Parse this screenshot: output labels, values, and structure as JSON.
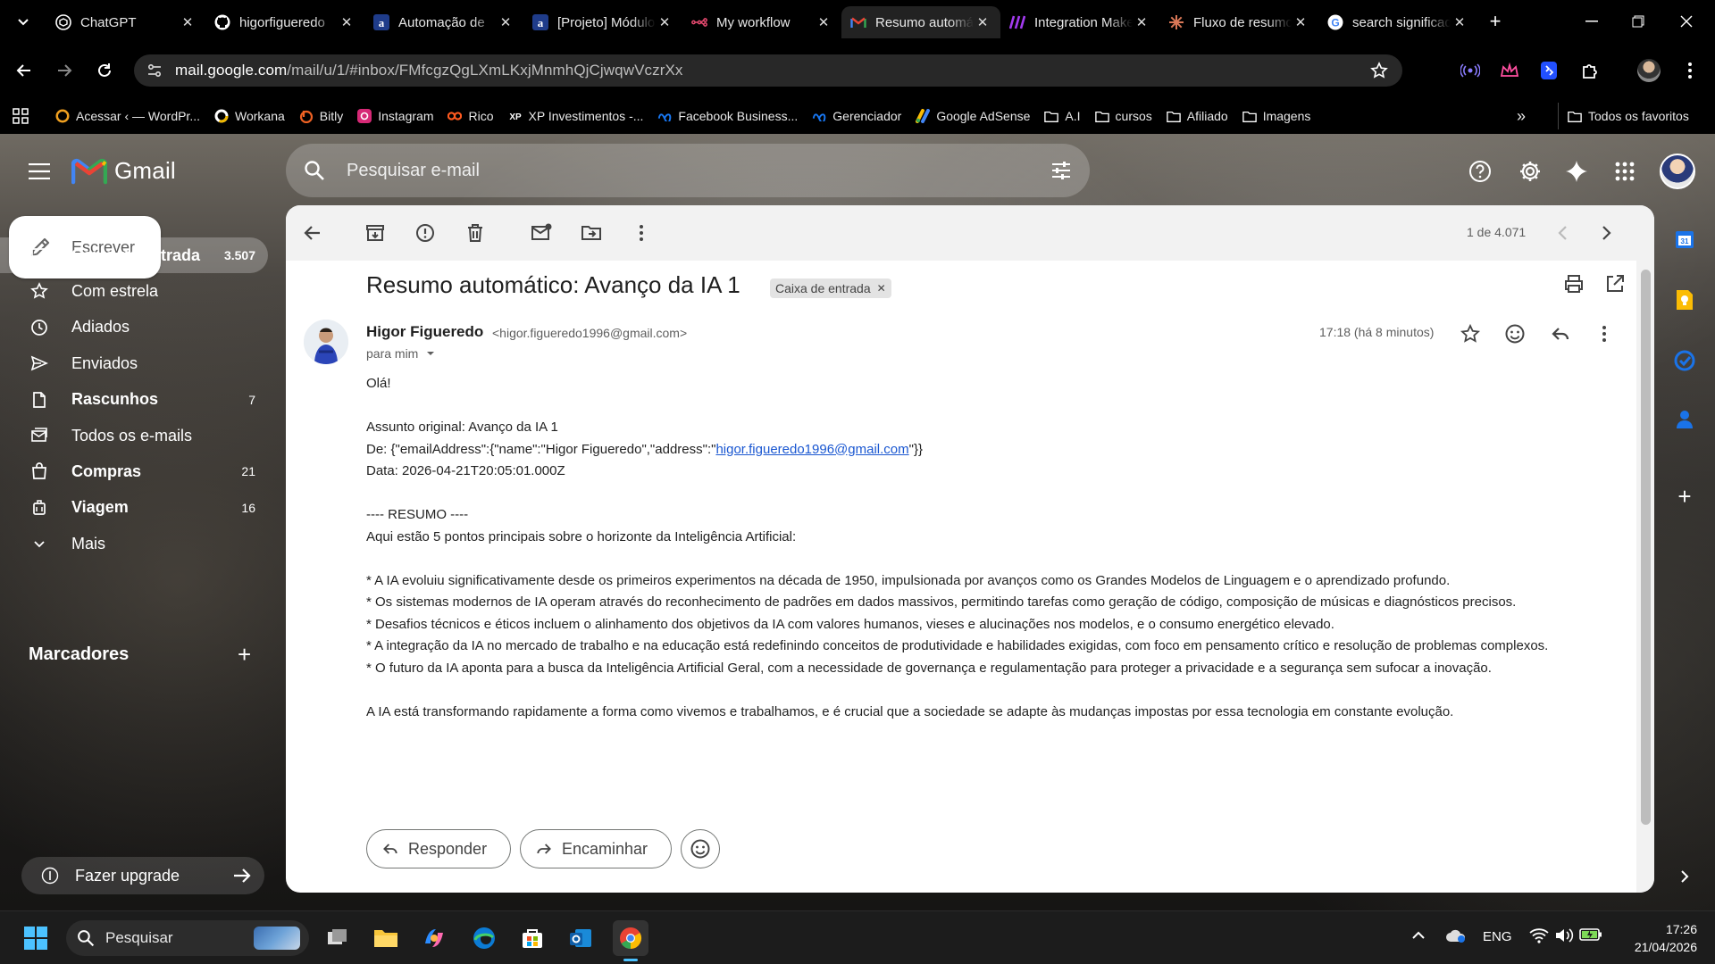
{
  "browser": {
    "tabs": [
      {
        "title": "ChatGPT",
        "icon": "chatgpt-icon"
      },
      {
        "title": "higorfigueredo",
        "icon": "github-icon"
      },
      {
        "title": "Automação de",
        "icon": "asana-a-icon"
      },
      {
        "title": "[Projeto] Módulo",
        "icon": "asana-a-icon"
      },
      {
        "title": "My workflow",
        "icon": "n8n-icon"
      },
      {
        "title": "Resumo automático",
        "icon": "gmail-icon",
        "active": true
      },
      {
        "title": "Integration Make",
        "icon": "make-icon"
      },
      {
        "title": "Fluxo de resumo",
        "icon": "claude-icon"
      },
      {
        "title": "search significado",
        "icon": "google-icon"
      }
    ],
    "url_host": "mail.google.com",
    "url_path": "/mail/u/1/#inbox/FMfcgzQgLXmLKxjMnmhQjCjwqwVczrXx",
    "bookmarks": [
      {
        "label": "Acessar ‹ — WordPr...",
        "icon": "wordpress-icon"
      },
      {
        "label": "Workana",
        "icon": "workana-icon"
      },
      {
        "label": "Bitly",
        "icon": "bitly-icon"
      },
      {
        "label": "Instagram",
        "icon": "instagram-icon"
      },
      {
        "label": "Rico",
        "icon": "rico-icon"
      },
      {
        "label": "XP Investimentos -...",
        "icon": "xp-icon"
      },
      {
        "label": "Facebook Business...",
        "icon": "meta-icon"
      },
      {
        "label": "Gerenciador",
        "icon": "meta-icon"
      },
      {
        "label": "Google AdSense",
        "icon": "adsense-icon"
      },
      {
        "label": "A.I",
        "icon": "folder-icon"
      },
      {
        "label": "cursos",
        "icon": "folder-icon"
      },
      {
        "label": "Afiliado",
        "icon": "folder-icon"
      },
      {
        "label": "Imagens",
        "icon": "folder-icon"
      }
    ],
    "bookmarks_more": "»",
    "all_bookmarks": "Todos os favoritos"
  },
  "gmail": {
    "logo_text": "Gmail",
    "search_placeholder": "Pesquisar e-mail",
    "compose": "Escrever",
    "nav": [
      {
        "label": "Caixa de entrada",
        "count": "3.507",
        "icon": "inbox-icon",
        "selected": true
      },
      {
        "label": "Com estrela",
        "count": "",
        "icon": "star-icon"
      },
      {
        "label": "Adiados",
        "count": "",
        "icon": "clock-icon"
      },
      {
        "label": "Enviados",
        "count": "",
        "icon": "send-icon"
      },
      {
        "label": "Rascunhos",
        "count": "7",
        "icon": "draft-icon",
        "bold": true
      },
      {
        "label": "Todos os e-mails",
        "count": "",
        "icon": "all-mail-icon"
      },
      {
        "label": "Compras",
        "count": "21",
        "icon": "shopping-icon",
        "bold": true
      },
      {
        "label": "Viagem",
        "count": "16",
        "icon": "luggage-icon",
        "bold": true
      },
      {
        "label": "Mais",
        "count": "",
        "icon": "chevron-down-icon"
      }
    ],
    "labels_heading": "Marcadores",
    "upgrade": "Fazer upgrade"
  },
  "message": {
    "counter": "1 de 4.071",
    "subject": "Resumo automático: Avanço da IA 1",
    "label_chip": "Caixa de entrada",
    "sender_name": "Higor Figueredo",
    "sender_email": "<higor.figueredo1996@gmail.com>",
    "to": "para mim",
    "time": "17:18 (há 8 minutos)",
    "body": {
      "greeting": "Olá!",
      "subject_line": "Assunto original: Avanço da IA 1",
      "from_prefix": "De: {\"emailAddress\":{\"name\":\"Higor Figueredo\",\"address\":\"",
      "from_link": "higor.figueredo1996@gmail.com",
      "from_suffix": "\"}}",
      "date_line": "Data: 2026-04-21T20:05:01.000Z",
      "summary_heading": "---- RESUMO ----",
      "intro": "Aqui estão 5 pontos principais sobre o horizonte da Inteligência Artificial:",
      "bullets": [
        "* A IA evoluiu significativamente desde os primeiros experimentos na década de 1950, impulsionada por avanços como os Grandes Modelos de Linguagem e o aprendizado profundo.",
        "* Os sistemas modernos de IA operam através do reconhecimento de padrões em dados massivos, permitindo tarefas como geração de código, composição de músicas e diagnósticos precisos.",
        "* Desafios técnicos e éticos incluem o alinhamento dos objetivos da IA com valores humanos, vieses e alucinações nos modelos, e o consumo energético elevado.",
        "* A integração da IA no mercado de trabalho e na educação está redefinindo conceitos de produtividade e habilidades exigidas, com foco em pensamento crítico e resolução de problemas complexos.",
        "* O futuro da IA aponta para a busca da Inteligência Artificial Geral, com a necessidade de governança e regulamentação para proteger a privacidade e a segurança sem sufocar a inovação."
      ],
      "closing": "A IA está transformando rapidamente a forma como vivemos e trabalhamos, e é crucial que a sociedade se adapte às mudanças impostas por essa tecnologia em constante evolução."
    },
    "reply": "Responder",
    "forward": "Encaminhar"
  },
  "taskbar": {
    "search": "Pesquisar",
    "language": "ENG",
    "time": "17:26",
    "date": "21/04/2026"
  },
  "colors": {
    "gmail_red": "#ea4335",
    "gmail_blue": "#4285f4",
    "gmail_green": "#34a853",
    "gmail_yellow": "#fbbc04",
    "link": "#1a57d1"
  }
}
